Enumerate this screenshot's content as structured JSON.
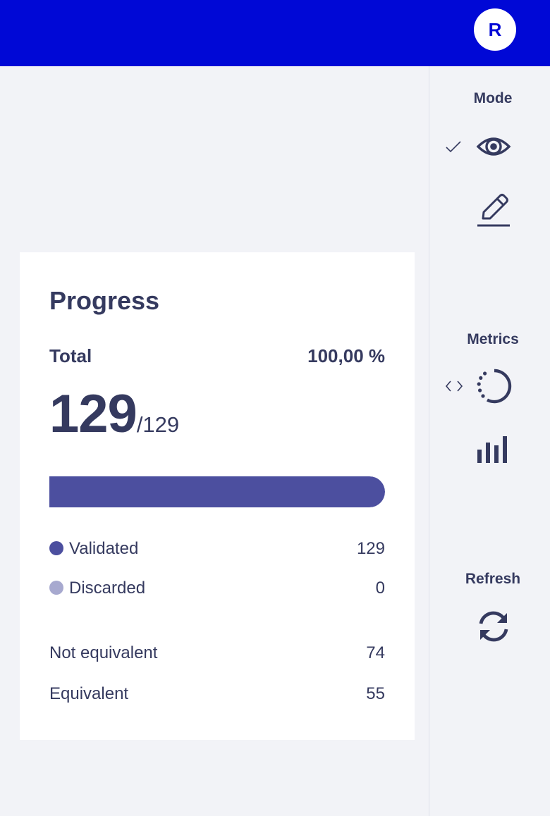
{
  "header": {
    "avatar_initial": "R",
    "background": "#0008d6"
  },
  "sidebar": {
    "mode": {
      "title": "Mode",
      "options": [
        {
          "icon": "eye-icon",
          "selected": true,
          "indicator": "check-icon"
        },
        {
          "icon": "pencil-icon",
          "selected": false
        }
      ]
    },
    "metrics": {
      "title": "Metrics",
      "options": [
        {
          "icon": "progress-circle-icon",
          "indicator": "code-brackets-icon"
        },
        {
          "icon": "bar-chart-icon"
        }
      ]
    },
    "refresh": {
      "title": "Refresh",
      "icon": "refresh-icon"
    }
  },
  "progress": {
    "title": "Progress",
    "total_label": "Total",
    "total_percent": "100,00 %",
    "completed_count": "129",
    "total_count": "/129",
    "bar_fraction": 1.0,
    "bar_color": "#4c4f9f",
    "status_rows": [
      {
        "label": "Validated",
        "value": "129",
        "color": "#4c4f9f"
      },
      {
        "label": "Discarded",
        "value": "0",
        "color": "#a7a9cf"
      }
    ],
    "detail_rows": [
      {
        "label": "Not equivalent",
        "value": "74"
      },
      {
        "label": "Equivalent",
        "value": "55"
      }
    ]
  }
}
